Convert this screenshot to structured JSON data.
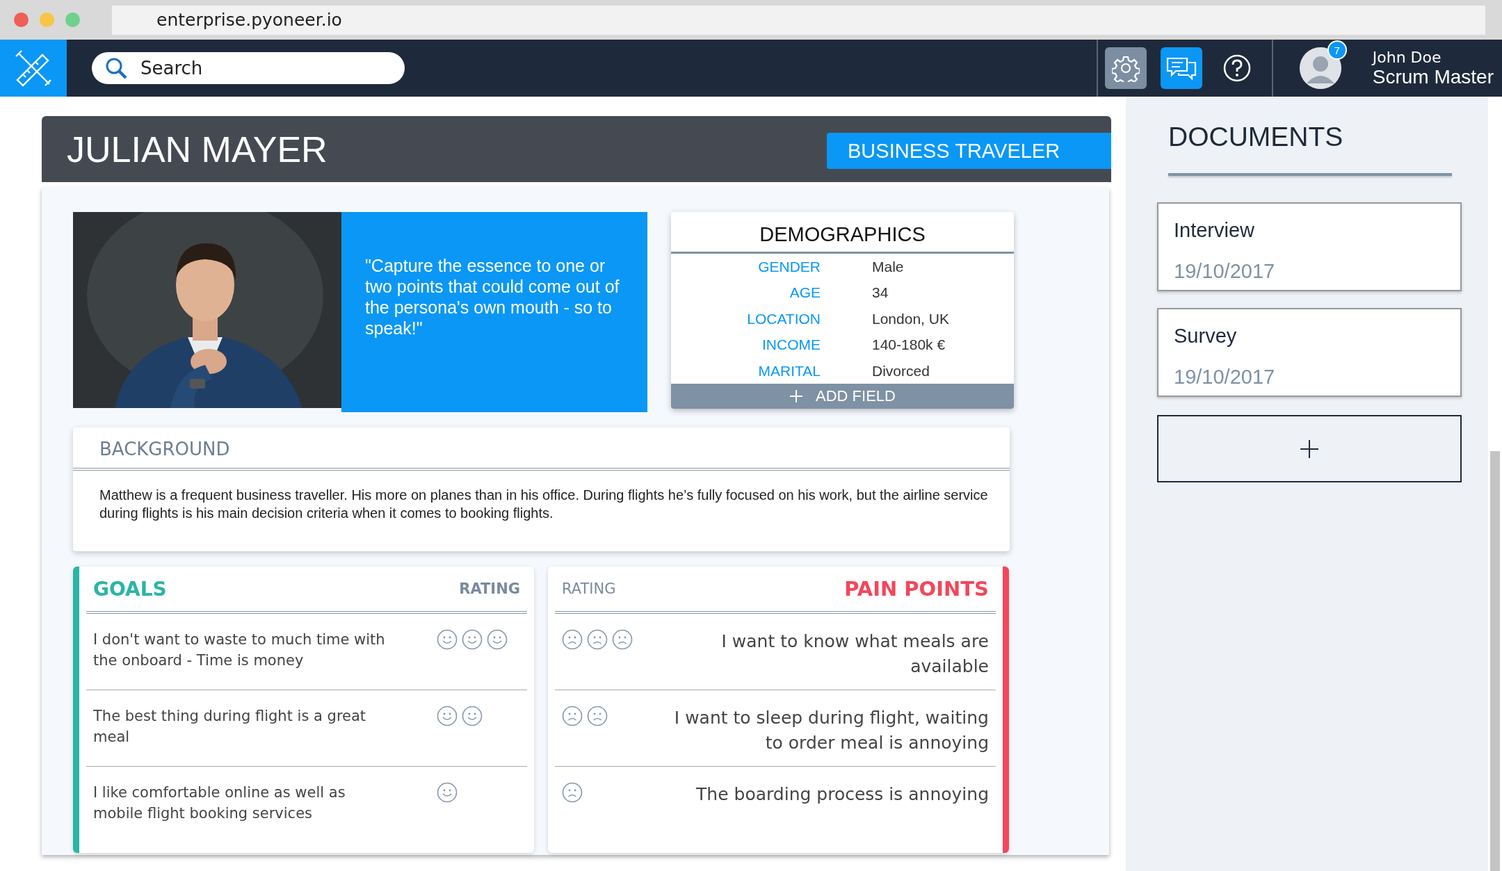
{
  "browser": {
    "url": "enterprise.pyoneer.io"
  },
  "topbar": {
    "search": {
      "placeholder": "Search"
    },
    "tools": [
      {
        "kind": "settings"
      },
      {
        "kind": "messages"
      },
      {
        "kind": "help"
      }
    ],
    "user": {
      "name": "John Doe",
      "role": "Scrum Master",
      "badge": "7"
    }
  },
  "persona": {
    "name": "JULIAN MAYER",
    "segment": "BUSINESS TRAVELER",
    "quote": "\"Capture the essence to one or two points that could come out of the persona's own mouth - so to speak!\"",
    "demographics": {
      "title": "DEMOGRAPHICS",
      "add_label": "ADD FIELD",
      "fields": [
        {
          "label": "GENDER",
          "value": "Male"
        },
        {
          "label": "AGE",
          "value": "34"
        },
        {
          "label": "LOCATION",
          "value": "London, UK"
        },
        {
          "label": "INCOME",
          "value": "140-180k €"
        },
        {
          "label": "MARITAL",
          "value": "Divorced"
        }
      ]
    },
    "background": {
      "title": "BACKGROUND",
      "text": "Matthew is a frequent business traveller. His more on planes than in his office. During flights he’s fully focused on his work, but the airline service during flights is his main decision criteria when it comes to booking flights."
    },
    "goals": {
      "title": "GOALS",
      "rating_label": "RATING",
      "items": [
        {
          "text": "I don't want to waste to much time with the onboard - Time is money",
          "rating": [
            {
              "kind": "happy"
            },
            {
              "kind": "happy"
            },
            {
              "kind": "happy"
            }
          ]
        },
        {
          "text": "The best thing during flight is a great meal",
          "rating": [
            {
              "kind": "happy"
            },
            {
              "kind": "happy"
            }
          ]
        },
        {
          "text": "I like comfortable online as well as mobile flight booking services",
          "rating": [
            {
              "kind": "happy"
            }
          ]
        }
      ]
    },
    "pain_points": {
      "title": "PAIN POINTS",
      "rating_label": "RATING",
      "items": [
        {
          "text": "I want to know what meals are available",
          "rating": [
            {
              "kind": "sad"
            },
            {
              "kind": "sad"
            },
            {
              "kind": "sad"
            }
          ]
        },
        {
          "text": "I want to sleep during flight, waiting to order meal is annoying",
          "rating": [
            {
              "kind": "sad"
            },
            {
              "kind": "sad"
            }
          ]
        },
        {
          "text": "The boarding process is annoying",
          "rating": [
            {
              "kind": "sad"
            }
          ]
        }
      ]
    }
  },
  "documents": {
    "title": "DOCUMENTS",
    "items": [
      {
        "name": "Interview",
        "date": "19/10/2017"
      },
      {
        "name": "Survey",
        "date": "19/10/2017"
      }
    ]
  }
}
